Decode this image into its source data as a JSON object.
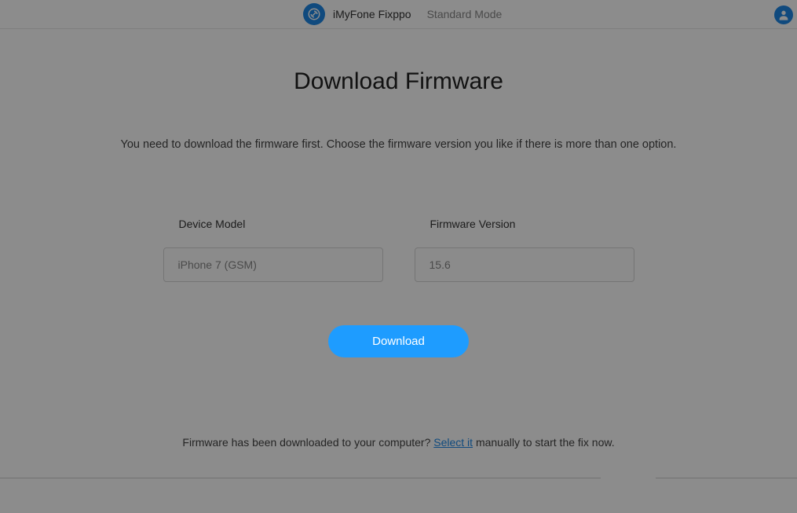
{
  "header": {
    "app_name": "iMyFone Fixppo",
    "mode": "Standard Mode"
  },
  "main": {
    "title": "Download Firmware",
    "description": "You need to download the firmware first. Choose the firmware version you like if there is more than one option.",
    "device_model": {
      "label": "Device Model",
      "value": "iPhone 7 (GSM)"
    },
    "firmware_version": {
      "label": "Firmware Version",
      "value": "15.6"
    },
    "download_button": "Download",
    "footer": {
      "prefix": "Firmware has been downloaded to your computer? ",
      "link": "Select it",
      "suffix": " manually to start the fix now."
    }
  }
}
